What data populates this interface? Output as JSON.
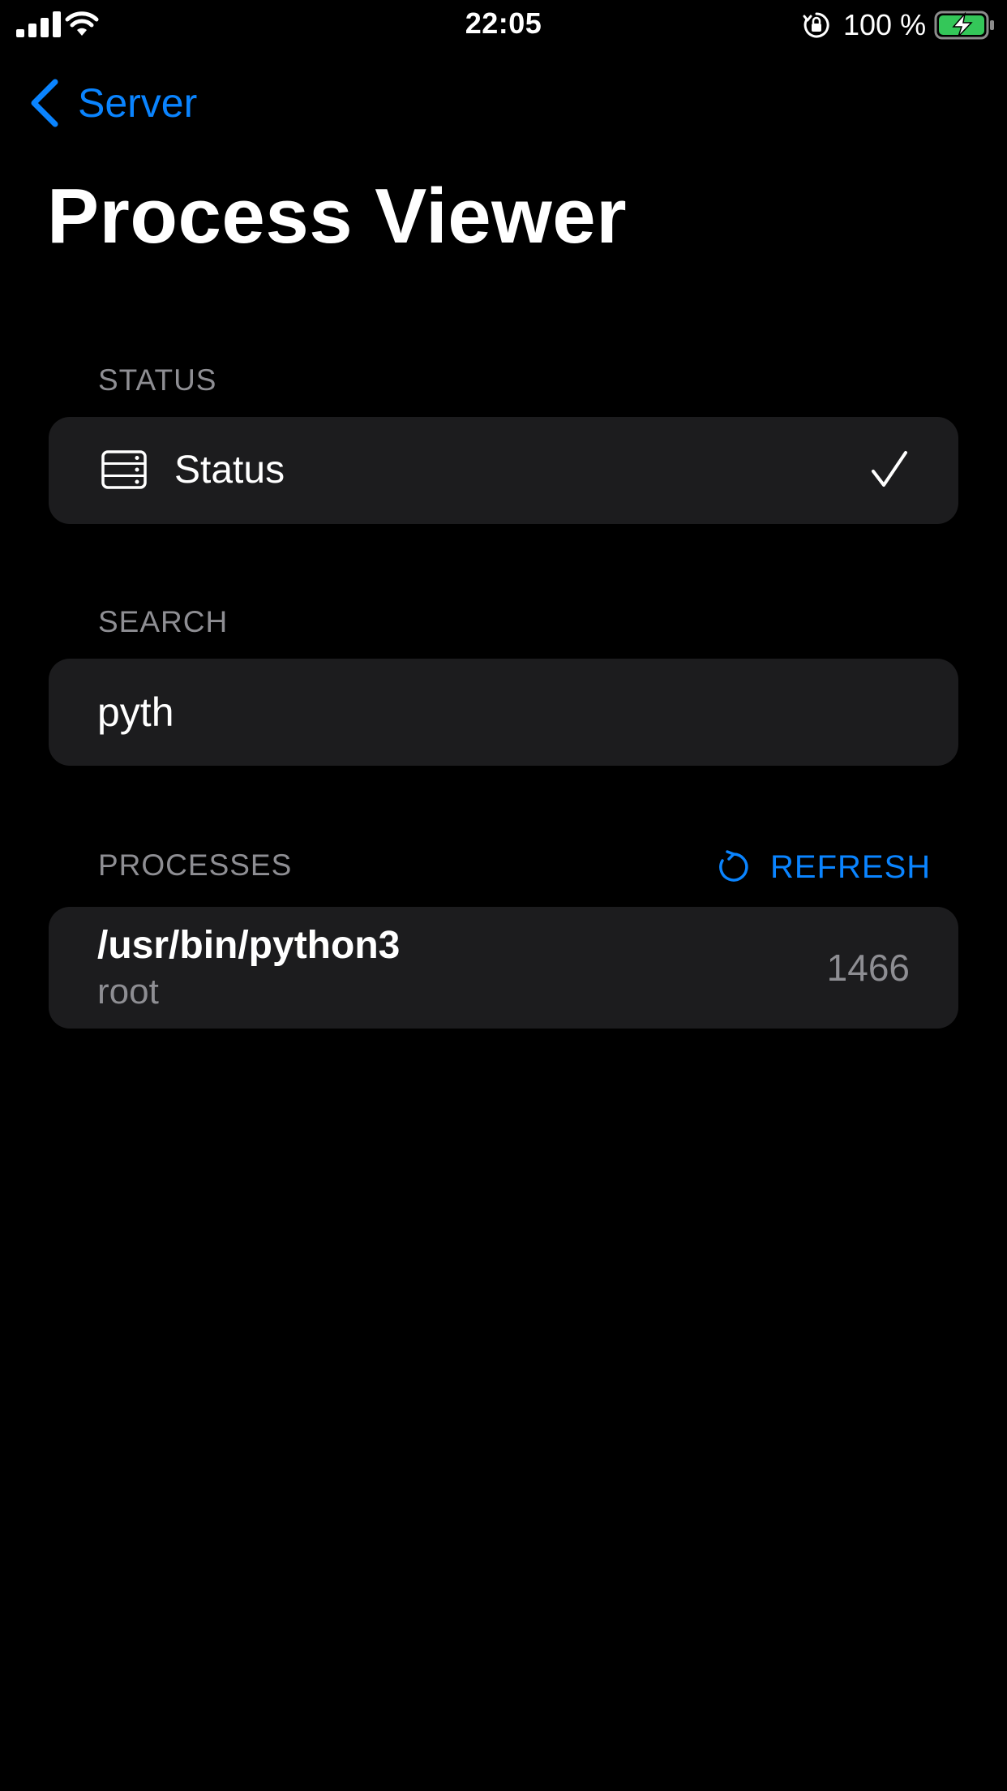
{
  "status_bar": {
    "time": "22:05",
    "battery_percent": "100 %",
    "signal_icon": "cellular-signal-icon",
    "wifi_icon": "wifi-icon",
    "lock_icon": "orientation-lock-icon",
    "battery_icon": "battery-charging-icon",
    "battery_level": 1.0,
    "battery_color": "#34c759"
  },
  "nav": {
    "back_label": "Server",
    "back_icon": "chevron-left-icon",
    "title": "Process Viewer"
  },
  "status_section": {
    "header": "STATUS",
    "row_label": "Status",
    "row_icon": "server-rack-icon",
    "selected": true,
    "check_icon": "checkmark-icon"
  },
  "search_section": {
    "header": "SEARCH",
    "value": "pyth"
  },
  "processes_section": {
    "header": "PROCESSES",
    "refresh_label": "REFRESH",
    "refresh_icon": "refresh-icon",
    "items": [
      {
        "name": "/usr/bin/python3",
        "user": "root",
        "pid": "1466"
      }
    ]
  },
  "colors": {
    "accent": "#0a84ff",
    "background": "#000000",
    "card": "#1c1c1e",
    "secondary_text": "#8e8e93"
  }
}
